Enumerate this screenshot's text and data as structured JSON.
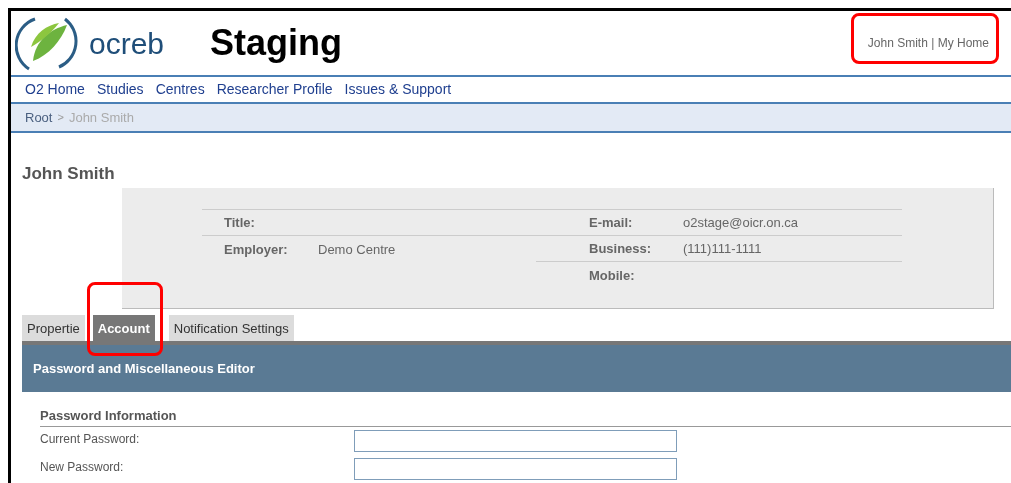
{
  "header": {
    "logo_text": "ocreb",
    "title": "Staging",
    "user_links": "John Smith | My Home"
  },
  "nav": [
    {
      "label": "O2 Home"
    },
    {
      "label": "Studies"
    },
    {
      "label": "Centres"
    },
    {
      "label": "Researcher Profile"
    },
    {
      "label": "Issues & Support"
    }
  ],
  "breadcrumb": [
    {
      "label": "Root",
      "kind": "link"
    },
    {
      "label": ">",
      "kind": "separator"
    },
    {
      "label": "John Smith",
      "kind": "current"
    }
  ],
  "page_title": "John Smith",
  "profile": {
    "left": [
      {
        "label": "Title:"
      },
      {
        "label": "Employer:",
        "value": "Demo Centre"
      }
    ],
    "right": [
      {
        "label": "E-mail:",
        "value": "o2stage@oicr.on.ca"
      },
      {
        "label": "Business:",
        "value": "(111)111-1111"
      },
      {
        "label": "Mobile:"
      }
    ]
  },
  "tabs": [
    {
      "label": "Propertie",
      "selected": false
    },
    {
      "label": "Account",
      "selected": true
    },
    {
      "label": "Notification Settings",
      "selected": false
    }
  ],
  "panel": {
    "title": "Password and Miscellaneous Editor",
    "section": "Password Information",
    "fields": [
      {
        "label": "Current Password:"
      },
      {
        "label": "New Password:"
      }
    ]
  },
  "annotations": [
    {
      "kind": "frame"
    },
    {
      "kind": "frame"
    }
  ]
}
